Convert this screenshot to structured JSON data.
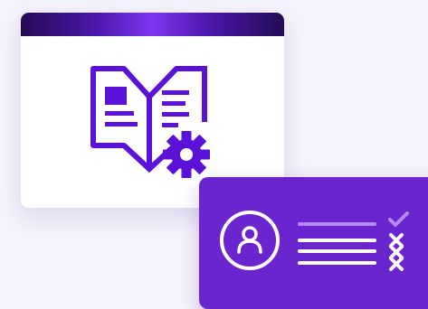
{
  "colors": {
    "background": "#f4f2fc",
    "card_background": "#ffffff",
    "titlebar_dark": "#240b56",
    "titlebar_glow": "#7f35f0",
    "icon_purple": "#5a12d8",
    "profile_card": "#6a25cf",
    "line_light": "#b68af5",
    "white": "#ffffff"
  },
  "icons": {
    "book": "open-book-with-text-lines",
    "gear": "settings-gear",
    "user": "user-avatar-circle",
    "check": "check-mark",
    "cross": "x-mark"
  }
}
